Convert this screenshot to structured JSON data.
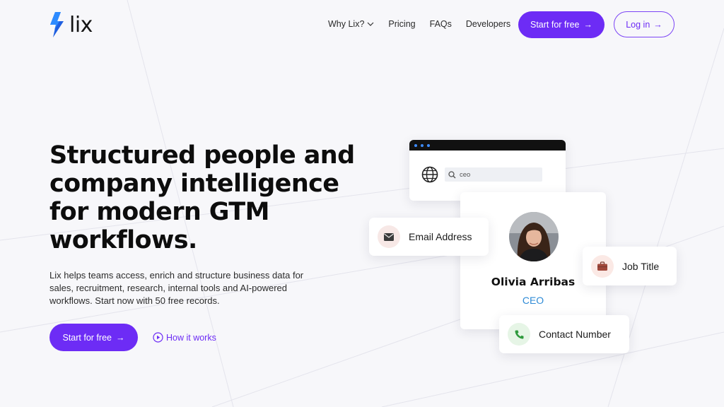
{
  "brand": {
    "name": "lix",
    "logo_icon": "lightning-bolt-icon",
    "accent": "#6d2cf5"
  },
  "nav": {
    "links": [
      {
        "label": "Why Lix?",
        "has_dropdown": true
      },
      {
        "label": "Pricing"
      },
      {
        "label": "FAQs"
      },
      {
        "label": "Developers"
      }
    ],
    "cta_label": "Start for free",
    "login_label": "Log in"
  },
  "hero": {
    "title_lines": [
      "Structured people and",
      "company intelligence",
      "for modern GTM",
      "workflows."
    ],
    "subtitle_lines": [
      "Lix helps teams access, enrich and structure business data for",
      "sales, recruitment, research, internal tools and AI-powered",
      "workflows. Start now with 50 free records."
    ],
    "cta_label": "Start for free",
    "how_label": "How it works"
  },
  "illustration": {
    "search_value": "ceo",
    "profile": {
      "name": "Olivia Arribas",
      "role": "CEO"
    },
    "chips": {
      "email": "Email Address",
      "job": "Job Title",
      "contact": "Contact Number"
    }
  }
}
